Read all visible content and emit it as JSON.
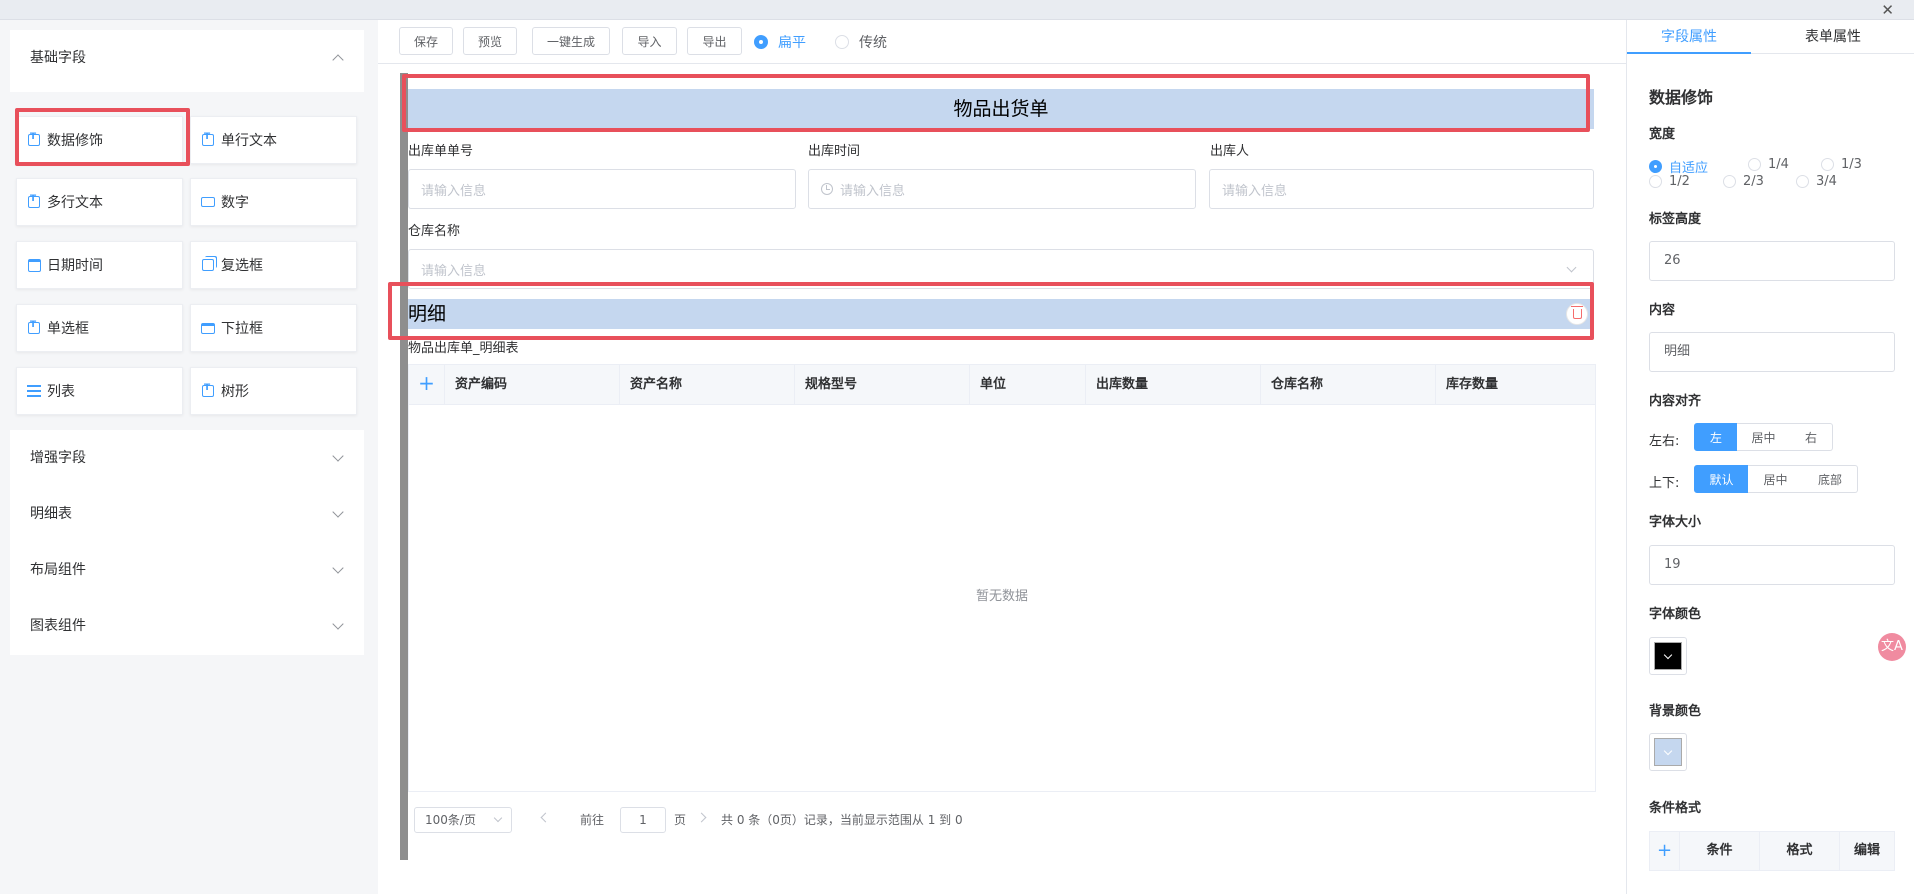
{
  "window": {
    "close_glyph": "✕"
  },
  "left_panel": {
    "basic_group": {
      "title": "基础字段",
      "items": [
        {
          "label": "数据修饰",
          "icon": "text-box-icon"
        },
        {
          "label": "单行文本",
          "icon": "text-box-icon"
        },
        {
          "label": "多行文本",
          "icon": "text-box-icon"
        },
        {
          "label": "数字",
          "icon": "number-icon"
        },
        {
          "label": "日期时间",
          "icon": "calendar-icon"
        },
        {
          "label": "复选框",
          "icon": "checkbox-icon"
        },
        {
          "label": "单选框",
          "icon": "text-box-icon"
        },
        {
          "label": "下拉框",
          "icon": "dropdown-icon"
        },
        {
          "label": "列表",
          "icon": "list-icon"
        },
        {
          "label": "树形",
          "icon": "text-box-icon"
        }
      ]
    },
    "collapsed_groups": [
      "增强字段",
      "明细表",
      "布局组件",
      "图表组件"
    ]
  },
  "toolbar": {
    "buttons": [
      "保存",
      "预览",
      "一键生成",
      "导入",
      "导出"
    ],
    "style_options": [
      "扁平",
      "传统"
    ],
    "style_selected": "扁平"
  },
  "form": {
    "title": "物品出货单",
    "fields": [
      {
        "label": "出库单单号",
        "placeholder": "请输入信息"
      },
      {
        "label": "出库时间",
        "placeholder": "请输入信息"
      },
      {
        "label": "出库人",
        "placeholder": "请输入信息"
      }
    ],
    "warehouse": {
      "label": "仓库名称",
      "placeholder": "请输入信息"
    },
    "detail_banner": "明细",
    "detail_table_label": "物品出库单_明细表",
    "add_glyph": "+",
    "columns": [
      "资产编码",
      "资产名称",
      "规格型号",
      "单位",
      "出库数量",
      "仓库名称",
      "库存数量"
    ],
    "empty_text": "暂无数据",
    "pagination": {
      "page_size": "100条/页",
      "goto_prefix": "前往",
      "page_value": "1",
      "goto_suffix": "页",
      "summary": "共 0 条（0页）记录，当前显示范围从 1 到 0"
    }
  },
  "right_panel": {
    "tabs": [
      "字段属性",
      "表单属性"
    ],
    "active_tab": "字段属性",
    "section_title": "数据修饰",
    "width": {
      "label": "宽度",
      "options": [
        "自适应",
        "1/4",
        "1/3",
        "1/2",
        "2/3",
        "3/4"
      ],
      "selected": "自适应"
    },
    "label_height": {
      "label": "标签高度",
      "value": "26"
    },
    "content": {
      "label": "内容",
      "value": "明细"
    },
    "align": {
      "label": "内容对齐",
      "horizontal_label": "左右:",
      "horizontal_options": [
        "左",
        "居中",
        "右"
      ],
      "horizontal_selected": "左",
      "vertical_label": "上下:",
      "vertical_options": [
        "默认",
        "居中",
        "底部"
      ],
      "vertical_selected": "默认"
    },
    "font_size": {
      "label": "字体大小",
      "value": "19"
    },
    "font_color": {
      "label": "字体颜色",
      "color": "#000000"
    },
    "bg_color": {
      "label": "背景颜色",
      "color": "#c5d7ef"
    },
    "condition_format": {
      "label": "条件格式",
      "add_glyph": "+",
      "columns": [
        "条件",
        "格式",
        "编辑"
      ]
    }
  },
  "floating": {
    "translate_glyph": "文A"
  },
  "colors": {
    "accent": "#409eff",
    "highlight_border": "#e8505b",
    "banner_bg": "#c5d7ef"
  }
}
